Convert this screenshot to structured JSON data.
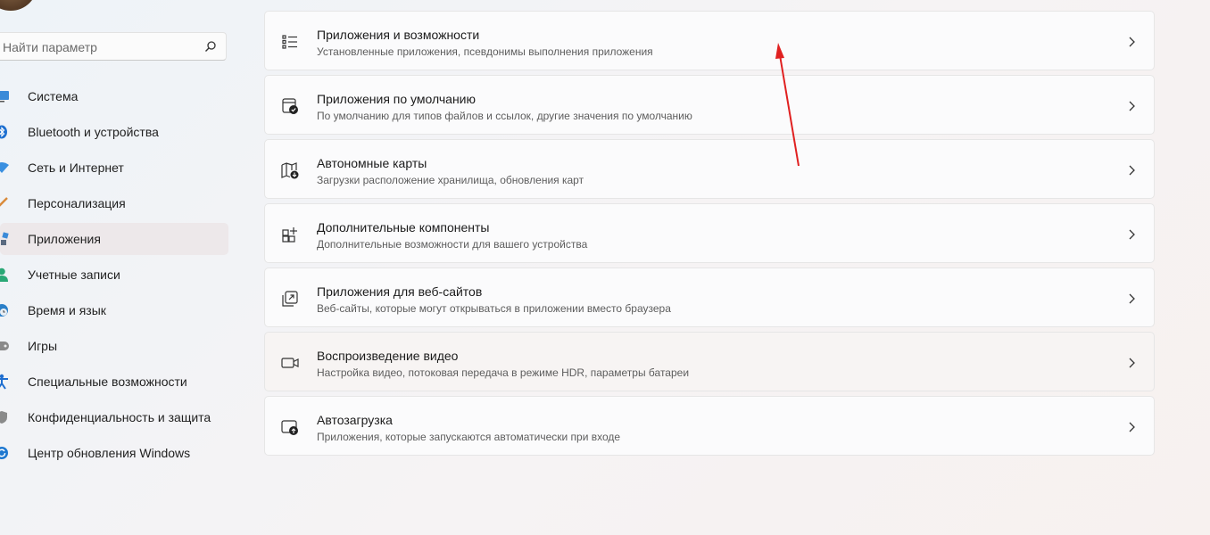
{
  "search": {
    "placeholder": "Найти параметр",
    "icon": "search-icon"
  },
  "sidebar": {
    "items": [
      {
        "label": "Система",
        "icon": "monitor-icon",
        "color": "#2b78c8"
      },
      {
        "label": "Bluetooth и устройства",
        "icon": "bluetooth-icon",
        "color": "#1e6fd0"
      },
      {
        "label": "Сеть и Интернет",
        "icon": "wifi-icon",
        "color": "#3a8fe0"
      },
      {
        "label": "Персонализация",
        "icon": "brush-icon",
        "color": "#d98a3a"
      },
      {
        "label": "Приложения",
        "icon": "apps-icon",
        "color": "#5a6a80",
        "active": true
      },
      {
        "label": "Учетные записи",
        "icon": "person-icon",
        "color": "#2aa876"
      },
      {
        "label": "Время и язык",
        "icon": "globe-clock-icon",
        "color": "#2a7fc8"
      },
      {
        "label": "Игры",
        "icon": "gamepad-icon",
        "color": "#7a7a7a"
      },
      {
        "label": "Специальные возможности",
        "icon": "accessibility-icon",
        "color": "#1f6fd0"
      },
      {
        "label": "Конфиденциальность и защита",
        "icon": "shield-icon",
        "color": "#8a8a8a"
      },
      {
        "label": "Центр обновления Windows",
        "icon": "update-icon",
        "color": "#1f78d0"
      }
    ]
  },
  "main": {
    "cards": [
      {
        "title": "Приложения и возможности",
        "subtitle": "Установленные приложения, псевдонимы выполнения приложения",
        "icon": "apps-list-icon"
      },
      {
        "title": "Приложения по умолчанию",
        "subtitle": "По умолчанию для типов файлов и ссылок, другие значения по умолчанию",
        "icon": "default-apps-icon"
      },
      {
        "title": "Автономные карты",
        "subtitle": "Загрузки расположение хранилища, обновления карт",
        "icon": "offline-map-icon"
      },
      {
        "title": "Дополнительные компоненты",
        "subtitle": "Дополнительные возможности для вашего устройства",
        "icon": "optional-features-icon"
      },
      {
        "title": "Приложения для веб-сайтов",
        "subtitle": "Веб-сайты, которые могут открываться в приложении вместо браузера",
        "icon": "web-apps-icon"
      },
      {
        "title": "Воспроизведение видео",
        "subtitle": "Настройка видео, потоковая передача в режиме HDR, параметры батареи",
        "icon": "video-icon"
      },
      {
        "title": "Автозагрузка",
        "subtitle": "Приложения, которые запускаются автоматически при входе",
        "icon": "startup-icon"
      }
    ]
  },
  "annotation": {
    "color": "#e02020"
  }
}
